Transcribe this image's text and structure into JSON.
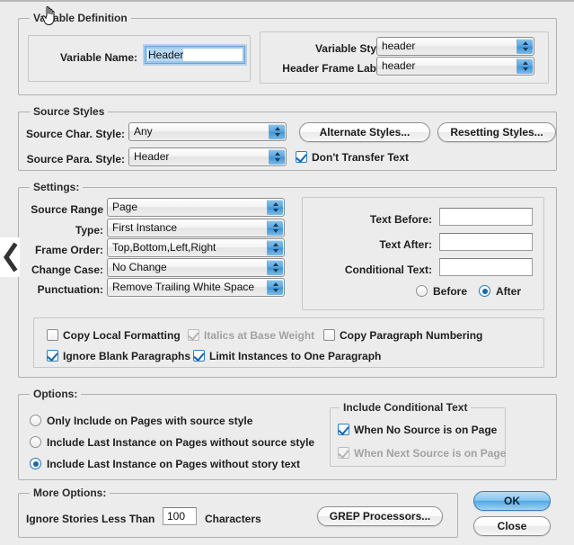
{
  "dialog": {
    "title": "Variable Definition"
  },
  "variable_definition": {
    "group_title": "Variable Definition",
    "variable_name_label": "Variable Name:",
    "variable_name_value": "Header",
    "variable_style_label": "Variable Style:",
    "variable_style_value": "header",
    "header_frame_label_label": "Header Frame Label:",
    "header_frame_label_value": "header"
  },
  "source_styles": {
    "group_title": "Source Styles",
    "source_char_style_label": "Source Char. Style:",
    "source_char_style_value": "Any",
    "source_para_style_label": "Source Para. Style:",
    "source_para_style_value": "Header",
    "alternate_styles_button": "Alternate Styles...",
    "resetting_styles_button": "Resetting Styles...",
    "dont_transfer_text_label": "Don't Transfer Text",
    "dont_transfer_text_checked": true
  },
  "settings": {
    "group_title": "Settings:",
    "source_range_label": "Source Range",
    "source_range_value": "Page",
    "type_label": "Type:",
    "type_value": "First Instance",
    "frame_order_label": "Frame Order:",
    "frame_order_value": "Top,Bottom,Left,Right",
    "change_case_label": "Change Case:",
    "change_case_value": "No Change",
    "punctuation_label": "Punctuation:",
    "punctuation_value": "Remove Trailing White Space",
    "text_before_label": "Text Before:",
    "text_before_value": "",
    "text_after_label": "Text After:",
    "text_after_value": "",
    "conditional_text_label": "Conditional Text:",
    "conditional_text_value": "",
    "before_radio_label": "Before",
    "after_radio_label": "After",
    "position_selected": "After",
    "checkboxes": [
      {
        "label": "Copy Local Formatting",
        "checked": false,
        "disabled": false
      },
      {
        "label": "Italics at Base Weight",
        "checked": true,
        "disabled": true
      },
      {
        "label": "Copy Paragraph Numbering",
        "checked": false,
        "disabled": false
      },
      {
        "label": "Ignore Blank Paragraphs",
        "checked": true,
        "disabled": false
      },
      {
        "label": "Limit Instances to One Paragraph",
        "checked": true,
        "disabled": false
      }
    ]
  },
  "options": {
    "group_title": "Options:",
    "radios": [
      {
        "label": "Only Include on Pages with source style",
        "selected": false
      },
      {
        "label": "Include Last Instance on Pages without source style",
        "selected": false
      },
      {
        "label": "Include Last Instance on Pages without story text",
        "selected": true
      }
    ],
    "include_conditional_text": {
      "group_title": "Include Conditional Text",
      "checkboxes": [
        {
          "label": "When No Source is on Page",
          "checked": true,
          "disabled": false
        },
        {
          "label": "When Next Source is on Page",
          "checked": true,
          "disabled": true
        }
      ]
    }
  },
  "more_options": {
    "group_title": "More Options:",
    "ignore_stories_label": "Ignore Stories Less Than",
    "ignore_stories_value": "100",
    "characters_label": "Characters",
    "grep_processors_button": "GREP Processors..."
  },
  "footer": {
    "ok_button": "OK",
    "close_button": "Close"
  },
  "overlays": {
    "left_chevron": "‹"
  },
  "colors": {
    "background": "#ececec",
    "accent_blue": "#1769b0",
    "default_button_blue": "#8bc8f1",
    "selection_blue": "#b7d8f0"
  }
}
